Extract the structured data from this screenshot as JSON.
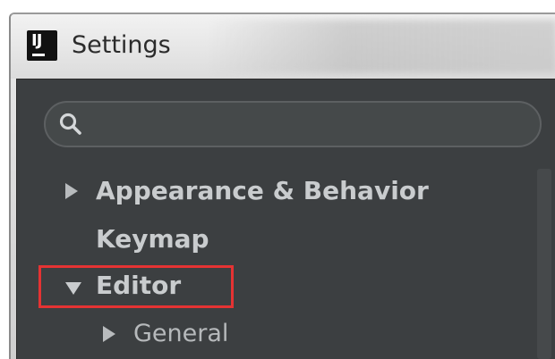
{
  "window": {
    "title": "Settings",
    "app_icon": "intellij-idea-icon",
    "app_icon_text": "IJ"
  },
  "search": {
    "placeholder": "",
    "value": "",
    "icon": "search-icon"
  },
  "tree": {
    "items": [
      {
        "label": "Appearance & Behavior",
        "expanded": false,
        "has_children": true,
        "level": 0
      },
      {
        "label": "Keymap",
        "expanded": false,
        "has_children": false,
        "level": 0
      },
      {
        "label": "Editor",
        "expanded": true,
        "has_children": true,
        "level": 0,
        "highlighted": true
      },
      {
        "label": "General",
        "expanded": false,
        "has_children": true,
        "level": 1
      }
    ]
  },
  "colors": {
    "panel_bg": "#3c3f41",
    "text": "#c9ccce",
    "highlight_border": "#e53333"
  }
}
